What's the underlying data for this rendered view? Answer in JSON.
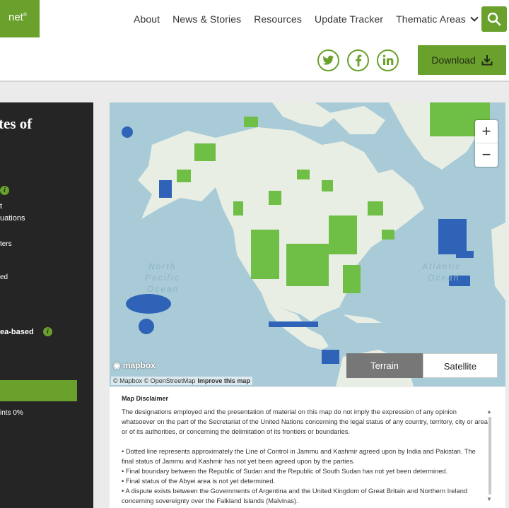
{
  "header": {
    "logo_text": "net",
    "logo_sup": "®",
    "nav": [
      "About",
      "News & Stories",
      "Resources",
      "Update Tracker",
      "Thematic Areas"
    ],
    "social": [
      "twitter-icon",
      "facebook-icon",
      "linkedin-icon"
    ],
    "download_label": "Download"
  },
  "sidebar": {
    "title": "tes of",
    "items": [
      {
        "text": "t"
      },
      {
        "text": "uations"
      },
      {
        "text": "ters"
      },
      {
        "text": "ed"
      },
      {
        "text": "ea-based"
      },
      {
        "text": "ints 0%"
      }
    ]
  },
  "map": {
    "ocean_labels": [
      "North",
      "Pacific",
      "Ocean",
      "Atlantic",
      "Ocean"
    ],
    "zoom_in": "+",
    "zoom_out": "−",
    "mode_terrain": "Terrain",
    "mode_satellite": "Satellite",
    "mapbox_logo": "mapbox",
    "attribution_1": "© Mapbox © OpenStreetMap",
    "attribution_2": "Improve this map"
  },
  "disclaimer": {
    "title": "Map Disclaimer",
    "paragraph": "The designations employed and the presentation of material on this map do not imply the expression of any opinion whatsoever on the part of the Secretariat of the United Nations concerning the legal status of any country, territory, city or area or of its authorities, or concerning the delimitation of its frontiers or boundaries.",
    "bullets": [
      "• Dotted line represents approximately the Line of Control in Jammu and Kashmir agreed upon by India and Pakistan. The final status of Jammu and Kashmir has not yet been agreed upon by the parties.",
      "• Final boundary between the Republic of Sudan and the Republic of South Sudan has not yet been determined.",
      "• Final status of the Abyei area is not yet determined.",
      "• A dispute exists between the Governments of Argentina and the United Kingdom of Great Britain and Northern Ireland concerning sovereignty over the Falkland Islands (Malvinas)."
    ]
  },
  "colors": {
    "brand_green": "#6aa12c",
    "sidebar_bg": "#252525",
    "ocean": "#a9cbd7",
    "land": "#e9eee4",
    "protected_area_green": "#6fbe45",
    "marine_area_blue": "#2f63b8"
  }
}
